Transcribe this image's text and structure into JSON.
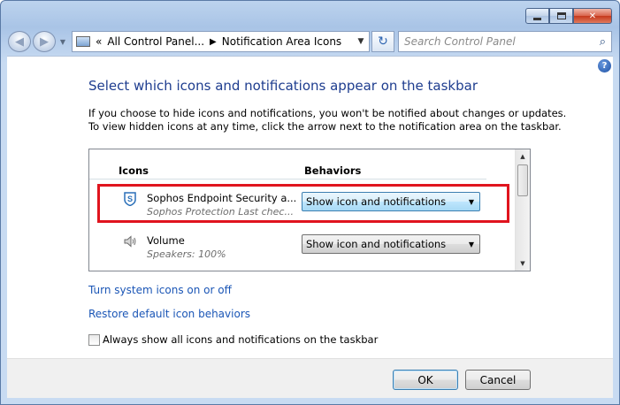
{
  "window": {
    "caption_minimize": "",
    "caption_maximize": "",
    "caption_close": "✕"
  },
  "nav": {
    "back_glyph": "◀",
    "forward_glyph": "▶",
    "dropdown_glyph": "▼",
    "chevrons": "«",
    "crumb_1": "All Control Panel...",
    "crumb_sep": "▶",
    "crumb_2": "Notification Area Icons",
    "address_drop": "▼",
    "refresh_glyph": "↻",
    "search_placeholder": "Search Control Panel",
    "search_glyph": "⌕"
  },
  "help_glyph": "?",
  "heading": "Select which icons and notifications appear on the taskbar",
  "description_line1": "If you choose to hide icons and notifications, you won't be notified about changes or updates.",
  "description_line2": "To view hidden icons at any time, click the arrow next to the notification area on the taskbar.",
  "list": {
    "col_icons": "Icons",
    "col_behaviors": "Behaviors",
    "rows": [
      {
        "name": "Sophos Endpoint Security a...",
        "sub": "Sophos Protection  Last chec...",
        "behavior": "Show icon and notifications",
        "icon": "sophos-shield-icon"
      },
      {
        "name": "Volume",
        "sub": "Speakers: 100%",
        "behavior": "Show icon and notifications",
        "icon": "speaker-icon"
      }
    ],
    "dropdown_arrow": "▼",
    "scroll_up": "▲",
    "scroll_down": "▼"
  },
  "links": {
    "system_icons": "Turn system icons on or off",
    "restore": "Restore default icon behaviors"
  },
  "checkbox": {
    "label": "Always show all icons and notifications on the taskbar",
    "checked": false
  },
  "buttons": {
    "ok": "OK",
    "cancel": "Cancel"
  },
  "colors": {
    "heading": "#1e3d8f",
    "link": "#1b56b6",
    "highlight": "#e0141e"
  }
}
